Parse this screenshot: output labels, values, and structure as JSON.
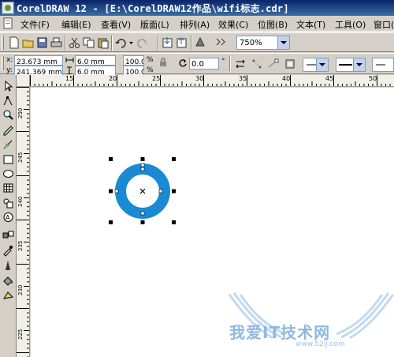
{
  "window": {
    "title": "CorelDRAW 12 - [E:\\CorelDRAW12作品\\wifi标志.cdr]"
  },
  "menu": {
    "items": [
      "文件(F)",
      "编辑(E)",
      "查看(V)",
      "版面(L)",
      "排列(A)",
      "效果(C)",
      "位图(B)",
      "文本(T)",
      "工具(O)",
      "窗口(W)"
    ]
  },
  "toolbar": {
    "zoom_value": "750%"
  },
  "property_bar": {
    "x_label": "x:",
    "x_value": "23.673 mm",
    "y_label": "y:",
    "y_value": "241.369 mm",
    "width_value": "6.0 mm",
    "height_value": "6.0 mm",
    "scale_x": "100.0",
    "scale_y": "100.0",
    "percent": "%",
    "rotation_value": "0.0",
    "degree": "°"
  },
  "rulers": {
    "h_labels": [
      "15",
      "20",
      "25",
      "30",
      "35",
      "40",
      "45",
      "50"
    ],
    "v_labels": [
      "250",
      "245",
      "240",
      "235",
      "230",
      "225"
    ]
  },
  "watermark": {
    "text": "我爱IT技术网",
    "url": "www.52ij.com"
  },
  "colors": {
    "ring": "#1a8ad4",
    "title_bar": "#0a246a"
  }
}
